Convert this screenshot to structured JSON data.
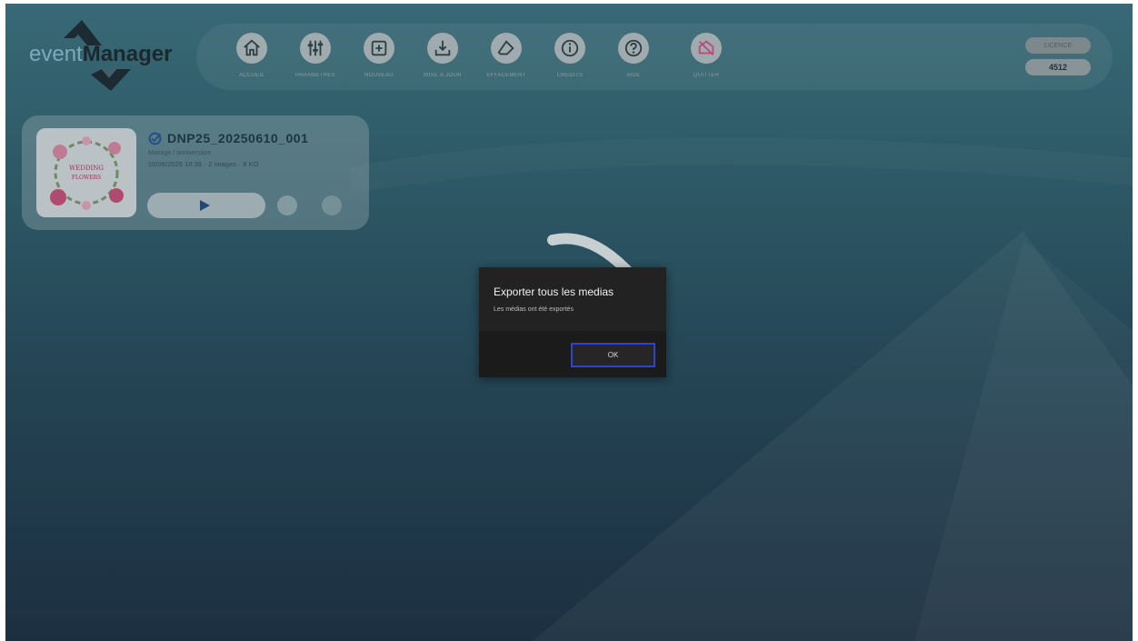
{
  "app": {
    "logo_part1": "event",
    "logo_part2": "Manager"
  },
  "toolbar": {
    "buttons": [
      {
        "label": "ACCUEIL",
        "icon": "home-icon"
      },
      {
        "label": "PARAMÈTRES",
        "icon": "sliders-icon"
      },
      {
        "label": "NOUVEAU",
        "icon": "plus-square-icon"
      },
      {
        "label": "MISE À JOUR",
        "icon": "download-icon"
      },
      {
        "label": "EFFACEMENT",
        "icon": "eraser-icon"
      },
      {
        "label": "CRÉDITS",
        "icon": "info-icon"
      },
      {
        "label": "AIDE",
        "icon": "help-icon"
      },
      {
        "label": "QUITTER",
        "icon": "exit-icon"
      }
    ],
    "pill_top": "LICENCE",
    "pill_bottom": "4512"
  },
  "event_card": {
    "title": "DNP25_20250610_001",
    "subtitle": "Mariage / anniversaire",
    "details": "10/06/2025 10:36 · 2 images · 8 KO",
    "thumbnail_text_line1": "WEDDING",
    "thumbnail_text_line2": "FLOWERS"
  },
  "dialog": {
    "title": "Exporter tous les medias",
    "message": "Les médias ont été exportés",
    "ok_label": "OK"
  },
  "colors": {
    "accent": "#2f44c8",
    "dialog_bg": "#222222",
    "quit_icon": "#d8508a"
  }
}
